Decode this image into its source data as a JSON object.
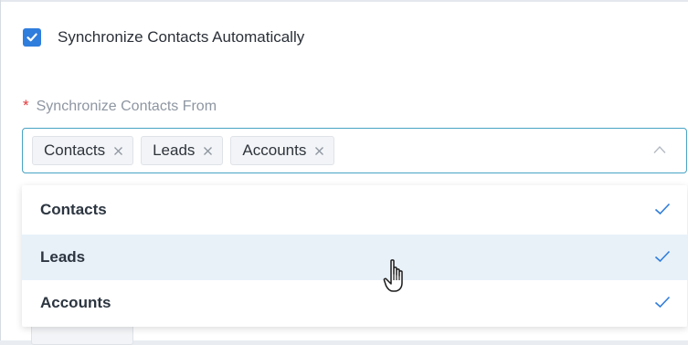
{
  "sync": {
    "checked": true,
    "label": "Synchronize Contacts Automatically"
  },
  "field": {
    "required_mark": "*",
    "label": "Synchronize Contacts From"
  },
  "selected_tags": [
    {
      "label": "Contacts"
    },
    {
      "label": "Leads"
    },
    {
      "label": "Accounts"
    }
  ],
  "options": [
    {
      "label": "Contacts",
      "selected": true
    },
    {
      "label": "Leads",
      "selected": true,
      "hovered": true
    },
    {
      "label": "Accounts",
      "selected": true
    }
  ],
  "colors": {
    "accent": "#2f7ddc",
    "focus_border": "#47a3c4",
    "hover_row": "#e8f1f8",
    "required": "#e5383b"
  },
  "icons": {
    "checkbox": "check-icon",
    "tag_remove": "close-icon",
    "dropdown_toggle": "chevron-up-icon",
    "option_selected": "check-icon",
    "pointer": "hand-cursor-icon"
  }
}
